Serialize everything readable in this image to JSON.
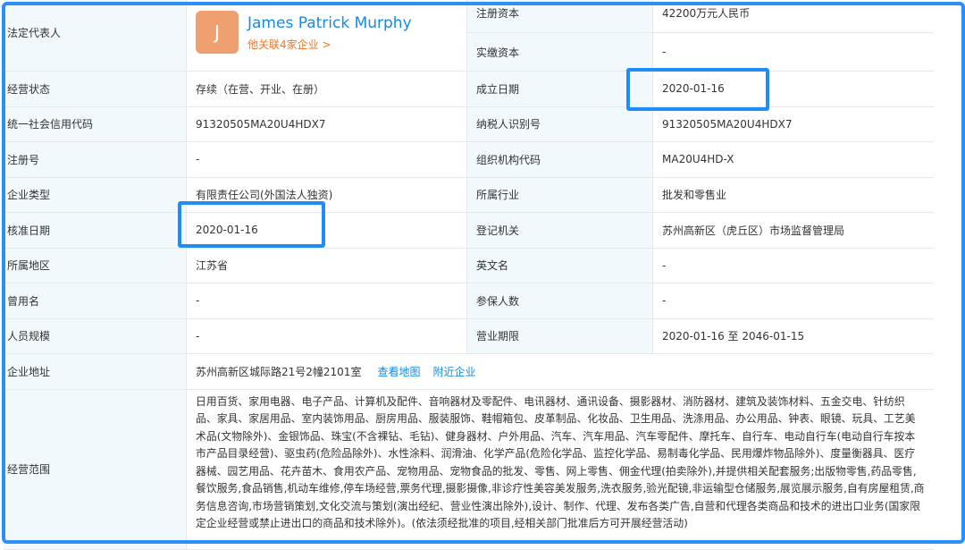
{
  "legal_rep": {
    "label": "法定代表人",
    "avatar_letter": "J",
    "name": "James Patrick Murphy",
    "related": "他关联4家企业 >"
  },
  "reg_capital": {
    "label": "注册资本",
    "value": "42200万元人民币"
  },
  "paid_capital": {
    "label": "实缴资本",
    "value": "-"
  },
  "rows": [
    {
      "l1": "经营状态",
      "v1": "存续（在营、开业、在册）",
      "l2": "成立日期",
      "v2": "2020-01-16"
    },
    {
      "l1": "统一社会信用代码",
      "v1": "91320505MA20U4HDX7",
      "l2": "纳税人识别号",
      "v2": "91320505MA20U4HDX7"
    },
    {
      "l1": "注册号",
      "v1": "-",
      "l2": "组织机构代码",
      "v2": "MA20U4HD-X"
    },
    {
      "l1": "企业类型",
      "v1": "有限责任公司(外国法人独资)",
      "l2": "所属行业",
      "v2": "批发和零售业"
    },
    {
      "l1": "核准日期",
      "v1": "2020-01-16",
      "l2": "登记机关",
      "v2": "苏州高新区（虎丘区）市场监督管理局"
    },
    {
      "l1": "所属地区",
      "v1": "江苏省",
      "l2": "英文名",
      "v2": "-"
    },
    {
      "l1": "曾用名",
      "v1": "-",
      "l2": "参保人数",
      "v2": "-"
    },
    {
      "l1": "人员规模",
      "v1": "-",
      "l2": "营业期限",
      "v2": "2020-01-16 至 2046-01-15"
    }
  ],
  "address": {
    "label": "企业地址",
    "value": "苏州高新区城际路21号2幢2101室",
    "map_link": "查看地图",
    "nearby_link": "附近企业"
  },
  "scope": {
    "label": "经营范围",
    "value": "日用百货、家用电器、电子产品、计算机及配件、音响器材及零配件、电讯器材、通讯设备、摄影器材、消防器材、建筑及装饰材料、五金交电、针纺织品、家具、家居用品、室内装饰用品、厨房用品、服装服饰、鞋帽箱包、皮革制品、化妆品、卫生用品、洗涤用品、办公用品、钟表、眼镜、玩具、工艺美术品(文物除外)、金银饰品、珠宝(不含裸钻、毛钻)、健身器材、户外用品、汽车、汽车用品、汽车零配件、摩托车、自行车、电动自行车(电动自行车按本市产品目录经营)、驱虫药(危险品除外)、水性涂料、润滑油、化学产品(危险化学品、监控化学品、易制毒化学品、民用爆炸物品除外)、度量衡器具、医疗器械、园艺用品、花卉苗木、食用农产品、宠物用品、宠物食品的批发、零售、网上零售、佣金代理(拍卖除外),并提供相关配套服务;出版物零售,药品零售,餐饮服务,食品销售,机动车维修,停车场经营,票务代理,摄影摄像,非诊疗性美容美发服务,洗衣服务,验光配镜,非运输型仓储服务,展览展示服务,自有房屋租赁,商务信息咨询,市场营销策划,文化交流与策划(演出经纪、营业性演出除外),设计、制作、代理、发布各类广告,自营和代理各类商品和技术的进出口业务(国家限定企业经营或禁止进出口的商品和技术除外)。(依法须经批准的项目,经相关部门批准后方可开展经营活动)"
  },
  "colors": {
    "label_bg": "#f2f9fc",
    "link": "#128bed",
    "highlight": "#1f8df5",
    "orange": "#f47421"
  }
}
